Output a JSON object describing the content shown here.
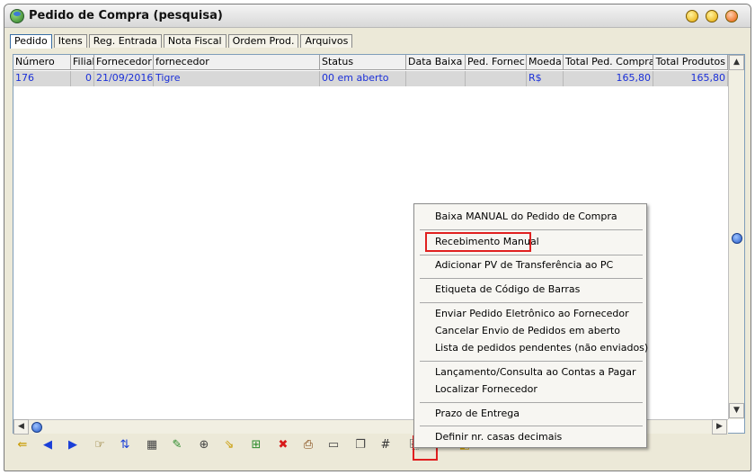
{
  "window": {
    "title": "Pedido de Compra  (pesquisa)"
  },
  "tabs": [
    "Pedido",
    "Itens",
    "Reg. Entrada",
    "Nota Fiscal",
    "Ordem Prod.",
    "Arquivos"
  ],
  "grid": {
    "headers": [
      "Número",
      "Filial",
      "Fornecedor",
      "fornecedor",
      "Status",
      "Data Baixa",
      "Ped. Fornec.",
      "Moeda",
      "Total Ped. Compra",
      "Total Produtos"
    ],
    "rows": [
      [
        "176",
        "0",
        "21/09/2016",
        "Tigre",
        "00 em aberto",
        "",
        "",
        "R$",
        "165,80",
        "165,80"
      ]
    ]
  },
  "context_menu": {
    "items": [
      "Baixa MANUAL do Pedido de Compra",
      "Recebimento Manual",
      "Adicionar PV de Transferência ao PC",
      "Etiqueta de Código de Barras",
      "Enviar Pedido Eletrônico ao Fornecedor",
      "Cancelar Envio de Pedidos em aberto",
      "Lista de pedidos pendentes (não enviados)",
      "Lançamento/Consulta ao Contas a Pagar",
      "Localizar Fornecedor",
      "Prazo de Entrega",
      "Definir nr. casas decimais"
    ]
  },
  "toolbar": {
    "icons": [
      {
        "name": "exit-icon",
        "glyph": "⇚",
        "color": "#c89a00"
      },
      {
        "name": "prev-arrow-icon",
        "glyph": "◀",
        "color": "#1a3fd8"
      },
      {
        "name": "next-arrow-icon",
        "glyph": "▶",
        "color": "#1a3fd8"
      },
      {
        "name": "hand-pointer-icon",
        "glyph": "☞",
        "color": "#7a5a00"
      },
      {
        "name": "sort-icon",
        "glyph": "⇅",
        "color": "#1a3fd8"
      },
      {
        "name": "calculator-icon",
        "glyph": "▦",
        "color": "#444"
      },
      {
        "name": "edit-icon",
        "glyph": "✎",
        "color": "#2a8a2a"
      },
      {
        "name": "zoom-icon",
        "glyph": "⊕",
        "color": "#444"
      },
      {
        "name": "folder-arrow-icon",
        "glyph": "⇘",
        "color": "#c89a00"
      },
      {
        "name": "tree-icon",
        "glyph": "⊞",
        "color": "#2a8a2a"
      },
      {
        "name": "delete-icon",
        "glyph": "✖",
        "color": "#d81a1a"
      },
      {
        "name": "print-icon",
        "glyph": "⎙",
        "color": "#7a3a00"
      },
      {
        "name": "card-icon",
        "glyph": "▭",
        "color": "#444"
      },
      {
        "name": "copy-icon",
        "glyph": "❐",
        "color": "#444"
      },
      {
        "name": "hash-icon",
        "glyph": "#",
        "color": "#333"
      },
      {
        "name": "menu-doc-icon",
        "glyph": "⎘",
        "color": "#444"
      },
      {
        "name": "list-icon",
        "glyph": "☰",
        "color": "#444"
      },
      {
        "name": "color-icon",
        "glyph": "◧",
        "color": "#d8a800"
      }
    ]
  }
}
